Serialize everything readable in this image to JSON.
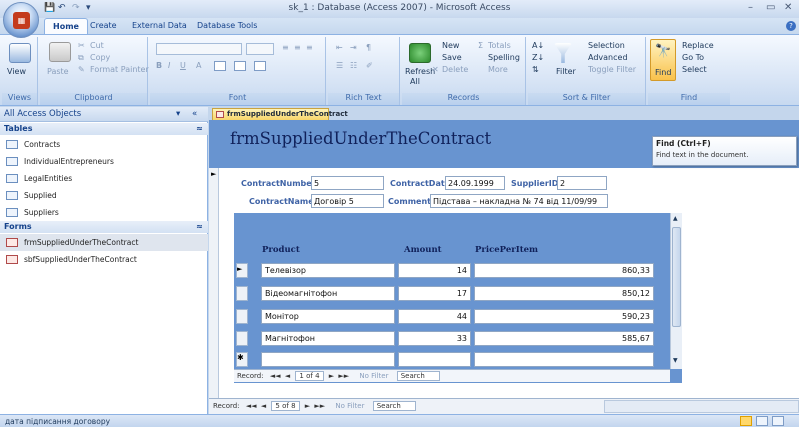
{
  "window": {
    "title": "sk_1 : Database (Access 2007) - Microsoft Access",
    "minimize": "–",
    "maximize": "▭",
    "close": "✕"
  },
  "ribbon_tabs": [
    "Home",
    "Create",
    "External Data",
    "Database Tools"
  ],
  "ribbon": {
    "views": {
      "view": "View",
      "label": "Views"
    },
    "clipboard": {
      "paste": "Paste",
      "cut": "Cut",
      "copy": "Copy",
      "format_painter": "Format Painter",
      "label": "Clipboard"
    },
    "font": {
      "label": "Font",
      "bold": "B",
      "italic": "I",
      "underline": "U"
    },
    "rich_text": {
      "label": "Rich Text"
    },
    "records": {
      "refresh": "Refresh",
      "refresh_sub": "All",
      "new": "New",
      "save": "Save",
      "delete": "Delete",
      "totals": "Totals",
      "spelling": "Spelling",
      "more": "More",
      "label": "Records"
    },
    "sort_filter": {
      "filter": "Filter",
      "selection": "Selection",
      "advanced": "Advanced",
      "toggle_filter": "Toggle Filter",
      "label": "Sort & Filter"
    },
    "find": {
      "find": "Find",
      "replace": "Replace",
      "goto": "Go To",
      "select": "Select",
      "label": "Find"
    }
  },
  "tooltip": {
    "title": "Find (Ctrl+F)",
    "text": "Find text in the document."
  },
  "nav": {
    "header": "All Access Objects",
    "tables_label": "Tables",
    "tables": [
      "Contracts",
      "IndividualEntrepreneurs",
      "LegalEntities",
      "Supplied",
      "Suppliers"
    ],
    "forms_label": "Forms",
    "forms": [
      "frmSuppliedUnderTheContract",
      "sbfSuppliedUnderTheContract"
    ]
  },
  "document_tab": "frmSuppliedUnderTheContract",
  "form": {
    "title": "frmSuppliedUnderTheContract",
    "contract_number_label": "ContractNumber",
    "contract_number": "5",
    "contract_date_label": "ContractDate",
    "contract_date": "24.09.1999",
    "supplier_id_label": "SupplierID",
    "supplier_id": "2",
    "contract_name_label": "ContractName",
    "contract_name": "Договір 5",
    "comment_label": "Comment",
    "comment": "Підстава – накладна № 74 від 11/09/99"
  },
  "subform": {
    "columns": [
      "Product",
      "Amount",
      "PricePerItem"
    ],
    "rows": [
      {
        "product": "Телевізор",
        "amount": "14",
        "price": "860,33"
      },
      {
        "product": "Відеомагнітофон",
        "amount": "17",
        "price": "850,12"
      },
      {
        "product": "Монітор",
        "amount": "44",
        "price": "590,23"
      },
      {
        "product": "Магнітофон",
        "amount": "33",
        "price": "585,67"
      }
    ],
    "nav": {
      "record_label": "Record:",
      "first": "◄◄",
      "prev": "◄",
      "position": "1 of 4",
      "next": "►",
      "last": "►►",
      "no_filter": "No Filter",
      "search": "Search"
    }
  },
  "main_nav": {
    "record_label": "Record:",
    "first": "◄◄",
    "prev": "◄",
    "position": "5 of 8",
    "next": "►",
    "last": "►►",
    "no_filter": "No Filter",
    "search": "Search"
  },
  "status": {
    "text": "дата підписання договору"
  }
}
